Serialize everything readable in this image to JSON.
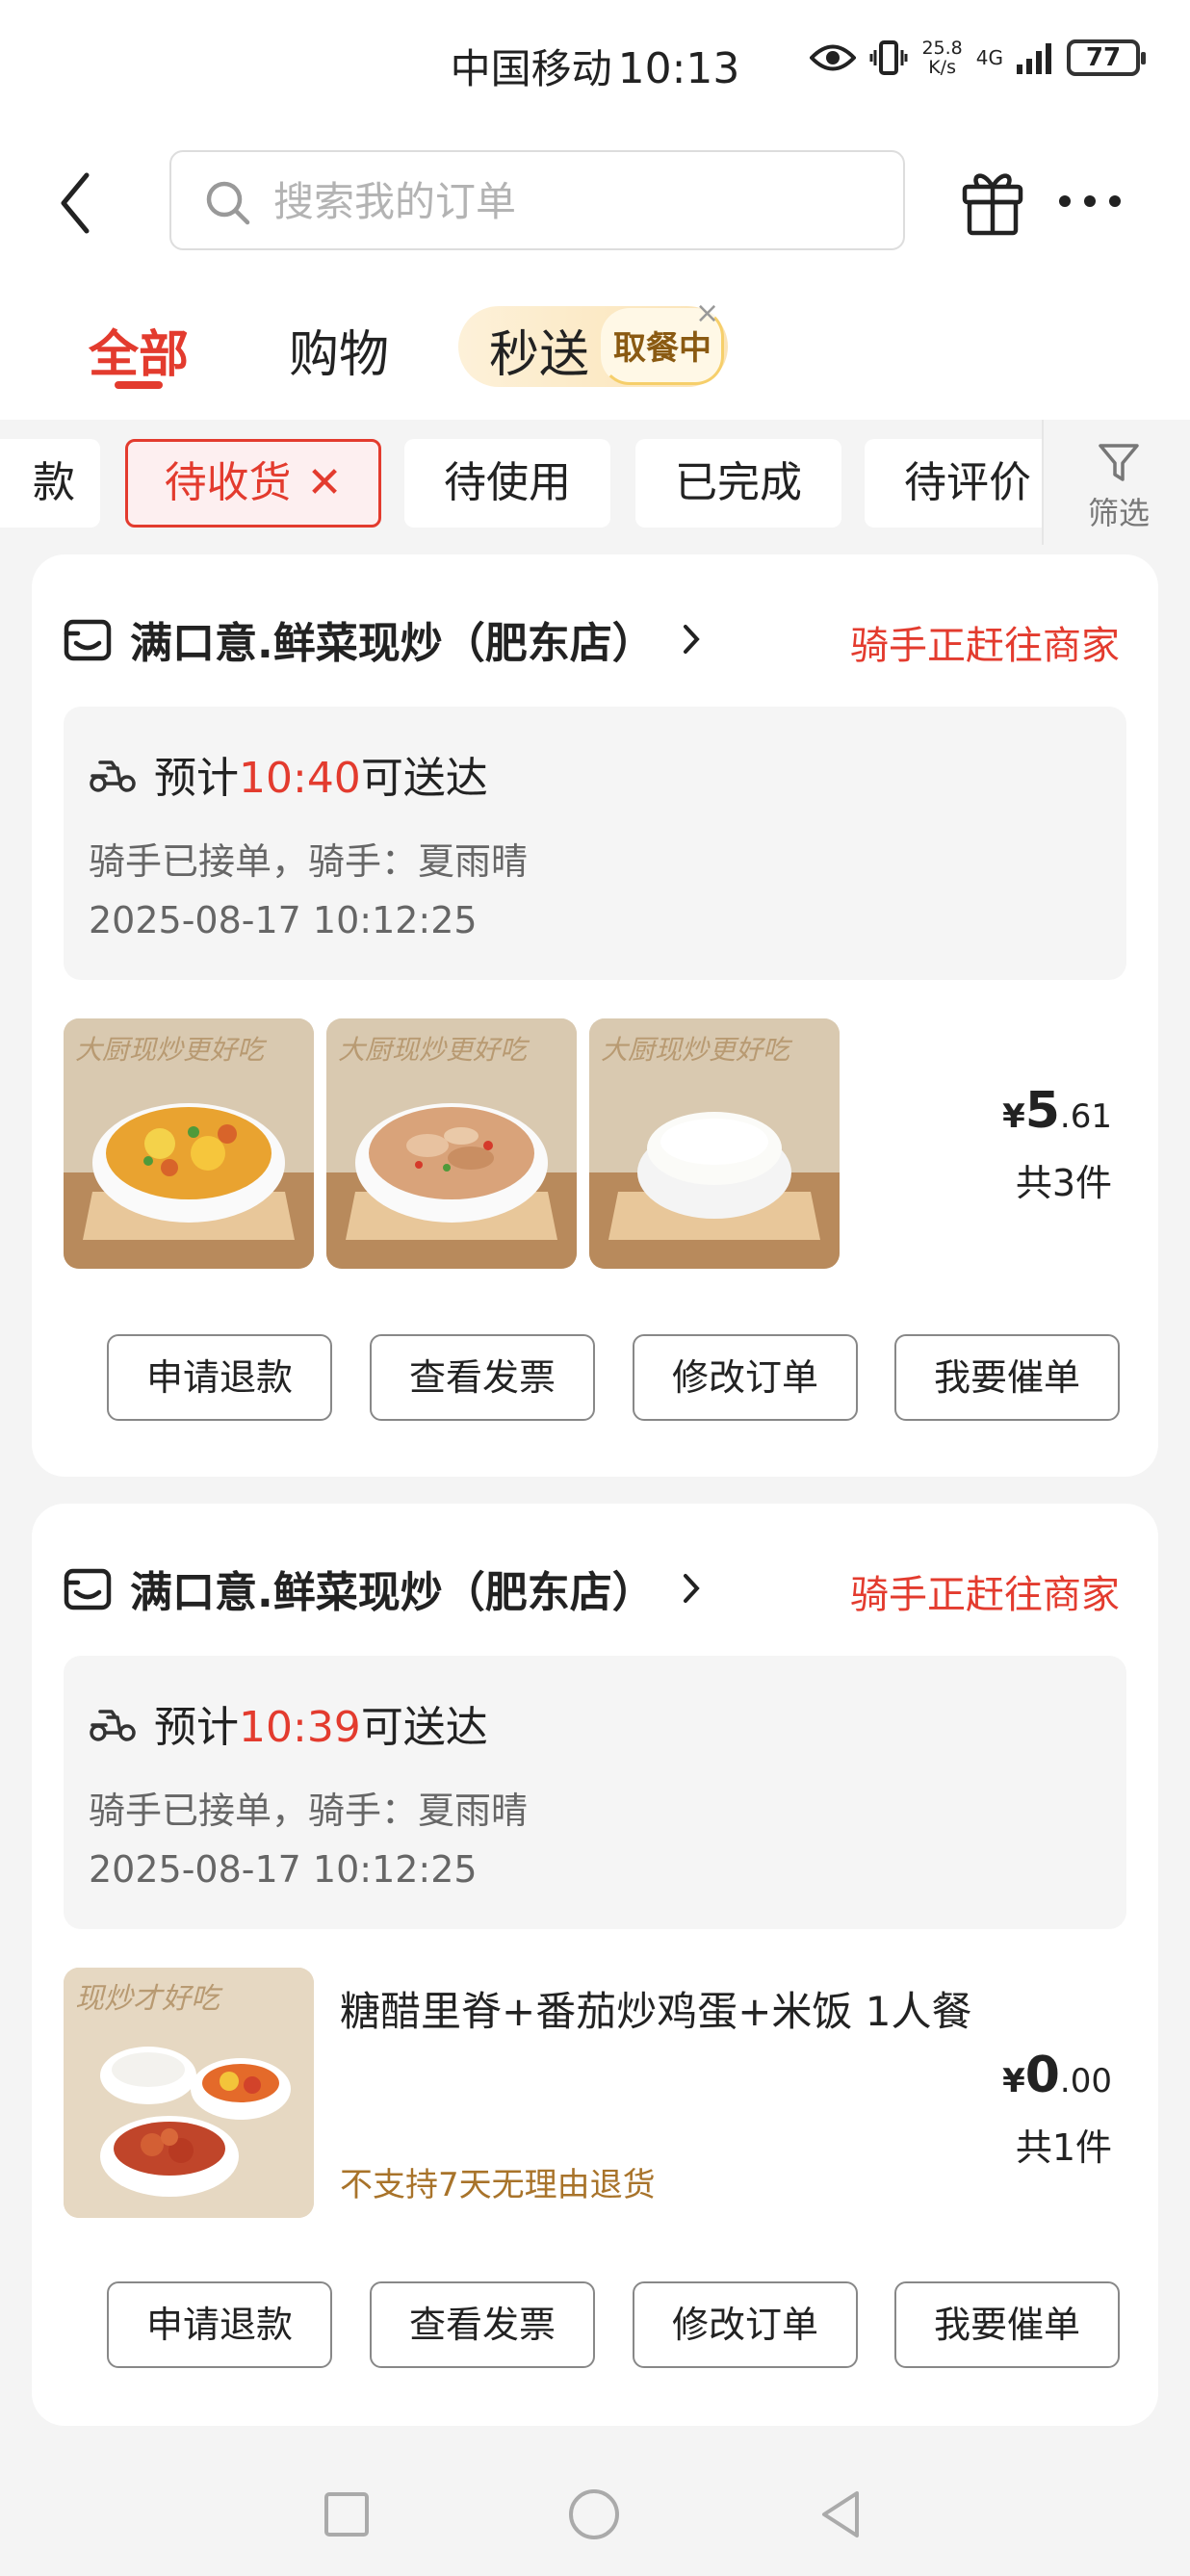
{
  "status_bar": {
    "carrier": "中国移动",
    "time": "10:13",
    "net_speed_value": "25.8",
    "net_speed_unit": "K/s",
    "network": "4G",
    "battery": "77"
  },
  "header": {
    "search_placeholder": "搜索我的订单"
  },
  "tabs": {
    "all": "全部",
    "shopping": "购物",
    "flash": "秒送",
    "flash_badge": "取餐中",
    "flash_close": "×"
  },
  "filters": {
    "partial": "款",
    "active": "待收货",
    "active_close": "✕",
    "items": [
      "待使用",
      "已完成",
      "待评价"
    ],
    "filter_label": "筛选"
  },
  "orders": [
    {
      "store": "满口意.鲜菜现炒（肥东店）",
      "status": "骑手正赶往商家",
      "eta_prefix": "预计",
      "eta_time": "10:40",
      "eta_suffix": "可送达",
      "rider": "骑手已接单，骑手：夏雨晴",
      "order_time": "2025-08-17 10:12:25",
      "thumb_caption": "大厨现炒更好吃",
      "price_symbol": "¥",
      "price_int": "5",
      "price_dec": ".61",
      "count": "共3件",
      "actions": [
        "申请退款",
        "查看发票",
        "修改订单",
        "我要催单"
      ]
    },
    {
      "store": "满口意.鲜菜现炒（肥东店）",
      "status": "骑手正赶往商家",
      "eta_prefix": "预计",
      "eta_time": "10:39",
      "eta_suffix": "可送达",
      "rider": "骑手已接单，骑手：夏雨晴",
      "order_time": "2025-08-17 10:12:25",
      "thumb_caption": "现炒才好吃",
      "item_title": "糖醋里脊+番茄炒鸡蛋+米饭 1人餐",
      "no_return": "不支持7天无理由退货",
      "price_symbol": "¥",
      "price_int": "0",
      "price_dec": ".00",
      "count": "共1件",
      "actions": [
        "申请退款",
        "查看发票",
        "修改订单",
        "我要催单"
      ]
    }
  ],
  "icons": {
    "back": "chevron-left-icon",
    "search": "search-icon",
    "gift": "gift-icon",
    "more": "more-icon",
    "filter": "funnel-icon",
    "store": "store-icon",
    "scooter": "scooter-icon"
  },
  "colors": {
    "accent": "#e33b2e",
    "warning_text": "#a8732a"
  }
}
